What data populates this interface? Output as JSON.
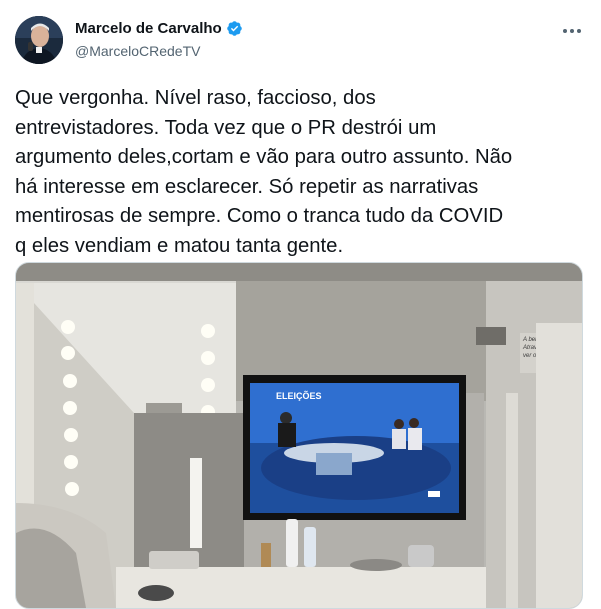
{
  "tweet": {
    "author_name": "Marcelo de Carvalho",
    "author_handle": "@MarceloCRedeTV",
    "verified": true,
    "text": "Que vergonha. Nível raso, faccioso, dos\nentrevistadores. Toda vez que o PR destrói um\nargumento deles,cortam e vão para outro assunto. Não\nhá  interesse em esclarecer. Só repetir as narrativas\nmentirosas de sempre. Como o tranca tudo da COVID\nq eles vendiam e matou tanta gente.",
    "more_icon": "more-horizontal-icon"
  },
  "media": {
    "tv_logo": "ELEIÇÕES",
    "wall_poster_text": "A beleza e a feli\nAtravés delas s\nver o nosso inter"
  },
  "colors": {
    "verified": "#1d9bf0",
    "text": "#0f1419",
    "secondary": "#536471",
    "border": "#cfd9de"
  }
}
